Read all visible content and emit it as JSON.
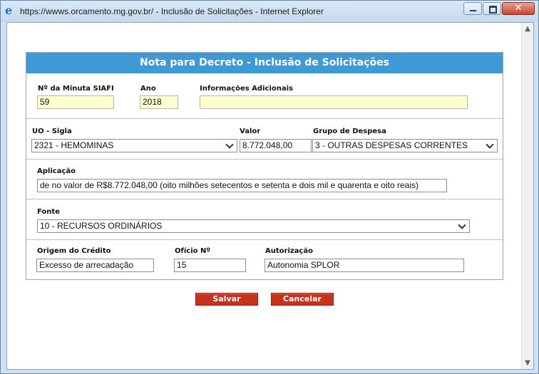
{
  "window": {
    "title": "https://wwws.orcamento.mg.gov.br/ - Inclusão de Solicitações - Internet Explorer",
    "close_glyph": "✕"
  },
  "form": {
    "header": "Nota para Decreto - Inclusão de Solicitações",
    "minuta": {
      "label": "Nº da Minuta SIAFI",
      "value": "59"
    },
    "ano": {
      "label": "Ano",
      "value": "2018"
    },
    "info": {
      "label": "Informações Adicionais",
      "value": ""
    },
    "uo": {
      "label": "UO - Sigla",
      "value": "2321 - HEMOMINAS"
    },
    "valor": {
      "label": "Valor",
      "value": "8.772.048,00"
    },
    "grupo": {
      "label": "Grupo de Despesa",
      "value": "3 - OUTRAS DESPESAS CORRENTES"
    },
    "aplicacao": {
      "label": "Aplicação",
      "value": "de no valor de R$8.772.048,00 (oito milhões setecentos e setenta e dois mil e quarenta e oito reais)"
    },
    "fonte": {
      "label": "Fonte",
      "value": "10 - RECURSOS ORDINÁRIOS"
    },
    "origem": {
      "label": "Origem do Crédito",
      "value": "Excesso de arrecadação"
    },
    "oficio": {
      "label": "Ofício Nº",
      "value": "15"
    },
    "autorizacao": {
      "label": "Autorização",
      "value": "Autonomia SPLOR"
    }
  },
  "buttons": {
    "save": "Salvar",
    "cancel": "Cancelar"
  },
  "icons": {
    "browser": "internet-explorer-icon",
    "scroll_up": "▲",
    "scroll_down": "▼"
  }
}
